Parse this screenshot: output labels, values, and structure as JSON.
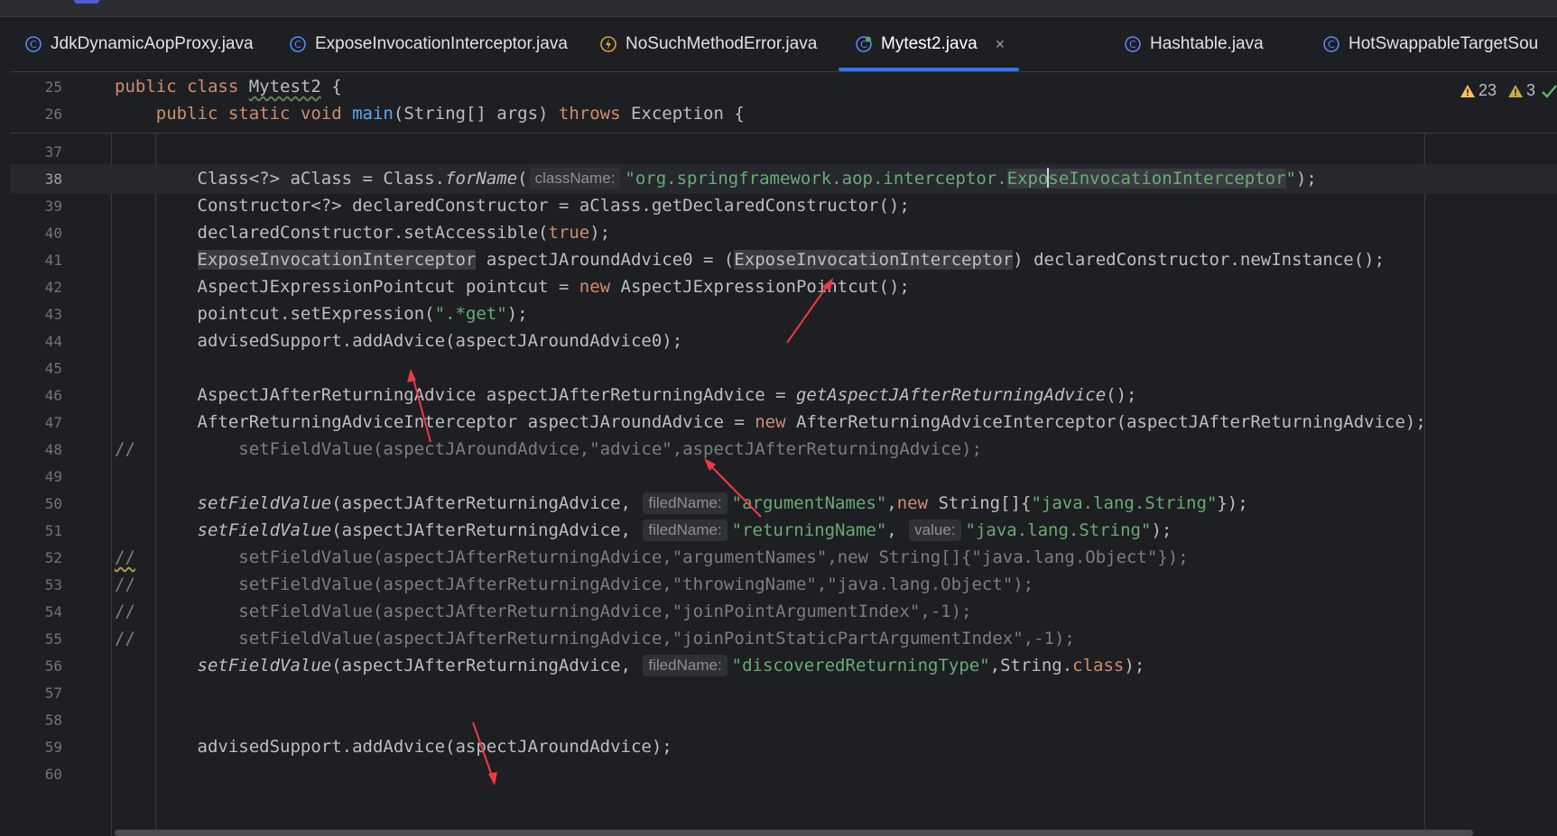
{
  "tabs": [
    {
      "label": "JdkDynamicAopProxy.java",
      "icon": "class-icon"
    },
    {
      "label": "ExposeInvocationInterceptor.java",
      "icon": "class-icon"
    },
    {
      "label": "NoSuchMethodError.java",
      "icon": "exception-icon"
    },
    {
      "label": "Mytest2.java",
      "icon": "class-icon",
      "active": true
    },
    {
      "label": "Hashtable.java",
      "icon": "class-icon"
    },
    {
      "label": "HotSwappableTargetSou",
      "icon": "class-icon"
    }
  ],
  "tab_close_glyph": "×",
  "inspections": {
    "warnings": "23",
    "weak_warnings": "3"
  },
  "lines": {
    "25": "25",
    "26": "26",
    "37": "37",
    "38": "38",
    "39": "39",
    "40": "40",
    "41": "41",
    "42": "42",
    "43": "43",
    "44": "44",
    "45": "45",
    "46": "46",
    "47": "47",
    "48": "48",
    "49": "49",
    "50": "50",
    "51": "51",
    "52": "52",
    "53": "53",
    "54": "54",
    "55": "55",
    "56": "56",
    "57": "57",
    "58": "58",
    "59": "59",
    "60": "60"
  },
  "code": {
    "l25": {
      "kw": "public class ",
      "name": "Mytest2",
      "rest": " {"
    },
    "l26": {
      "indent": "    ",
      "kw": "public static void ",
      "fn": "main",
      "args": "(String[] args) ",
      "kw2": "throws",
      "rest": " Exception {"
    },
    "l38": {
      "indent": "        ",
      "a": "Class<?> aClass = Class.",
      "fn": "forName",
      "b": "(",
      "hint": "className:",
      "str1": "\"org.springframework.aop.interceptor.",
      "str_hl_a": "Expo",
      "str_hl_b": "seInvocationInterceptor",
      "str2": "\"",
      "c": ");"
    },
    "l39": {
      "indent": "        ",
      "text": "Constructor<?> declaredConstructor = aClass.getDeclaredConstructor();"
    },
    "l40": {
      "indent": "        ",
      "a": "declaredConstructor.setAccessible(",
      "kw": "true",
      "b": ");"
    },
    "l41": {
      "indent": "        ",
      "hl1": "ExposeInvocationInterceptor",
      "a": " aspectJAroundAdvice0 = (",
      "hl2": "ExposeInvocationInterceptor",
      "b": ") declaredConstructor.newInstance();"
    },
    "l42": {
      "indent": "        ",
      "a": "AspectJExpressionPointcut pointcut = ",
      "kw": "new",
      "b": " AspectJExpressionPointcut();"
    },
    "l43": {
      "indent": "        ",
      "a": "pointcut.setExpression(",
      "str": "\".*get\"",
      "b": ");"
    },
    "l44": {
      "indent": "        ",
      "text": "advisedSupport.addAdvice(aspectJAroundAdvice0);"
    },
    "l46": {
      "indent": "        ",
      "a": "AspectJAfterReturningAdvice aspectJAfterReturningAdvice = ",
      "it": "getAspectJAfterReturningAdvice",
      "b": "();"
    },
    "l47": {
      "indent": "        ",
      "a": "AfterReturningAdviceInterceptor aspectJAroundAdvice = ",
      "kw": "new",
      "b": " AfterReturningAdviceInterceptor(aspectJAfterReturningAdvice);"
    },
    "l48": {
      "prefix": "//",
      "text": "          setFieldValue(aspectJAroundAdvice,\"advice\",aspectJAfterReturningAdvice);"
    },
    "l50": {
      "indent": "        ",
      "it": "setFieldValue",
      "a": "(aspectJAfterReturningAdvice, ",
      "hint": "filedName:",
      "str1": "\"argumentNames\"",
      "b": ",",
      "kw": "new",
      "c": " String[]{",
      "str2": "\"java.lang.String\"",
      "d": "});"
    },
    "l51": {
      "indent": "        ",
      "it": "setFieldValue",
      "a": "(aspectJAfterReturningAdvice, ",
      "hint": "filedName:",
      "str1": "\"returningName\"",
      "b": ", ",
      "hint2": "value:",
      "str2": "\"java.lang.String\"",
      "c": ");"
    },
    "l52": {
      "prefix": "//",
      "text": "          setFieldValue(aspectJAfterReturningAdvice,\"argumentNames\",new String[]{\"java.lang.Object\"});"
    },
    "l53": {
      "prefix": "//",
      "text": "          setFieldValue(aspectJAfterReturningAdvice,\"throwingName\",\"java.lang.Object\");"
    },
    "l54": {
      "prefix": "//",
      "text": "          setFieldValue(aspectJAfterReturningAdvice,\"joinPointArgumentIndex\",-1);"
    },
    "l55": {
      "prefix": "//",
      "text": "          setFieldValue(aspectJAfterReturningAdvice,\"joinPointStaticPartArgumentIndex\",-1);"
    },
    "l56": {
      "indent": "        ",
      "it": "setFieldValue",
      "a": "(aspectJAfterReturningAdvice, ",
      "hint": "filedName:",
      "str": "\"discoveredReturningType\"",
      "b": ",String.",
      "kw": "class",
      "c": ");"
    },
    "l59": {
      "indent": "        ",
      "text": "advisedSupport.addAdvice(aspectJAroundAdvice);"
    }
  },
  "colors": {
    "keyword": "#cf8e6d",
    "string": "#6aab73",
    "function": "#56a8f5",
    "comment": "#7a7e85",
    "annotation_arrow": "#ee3a48",
    "tab_underline": "#3574f0"
  }
}
